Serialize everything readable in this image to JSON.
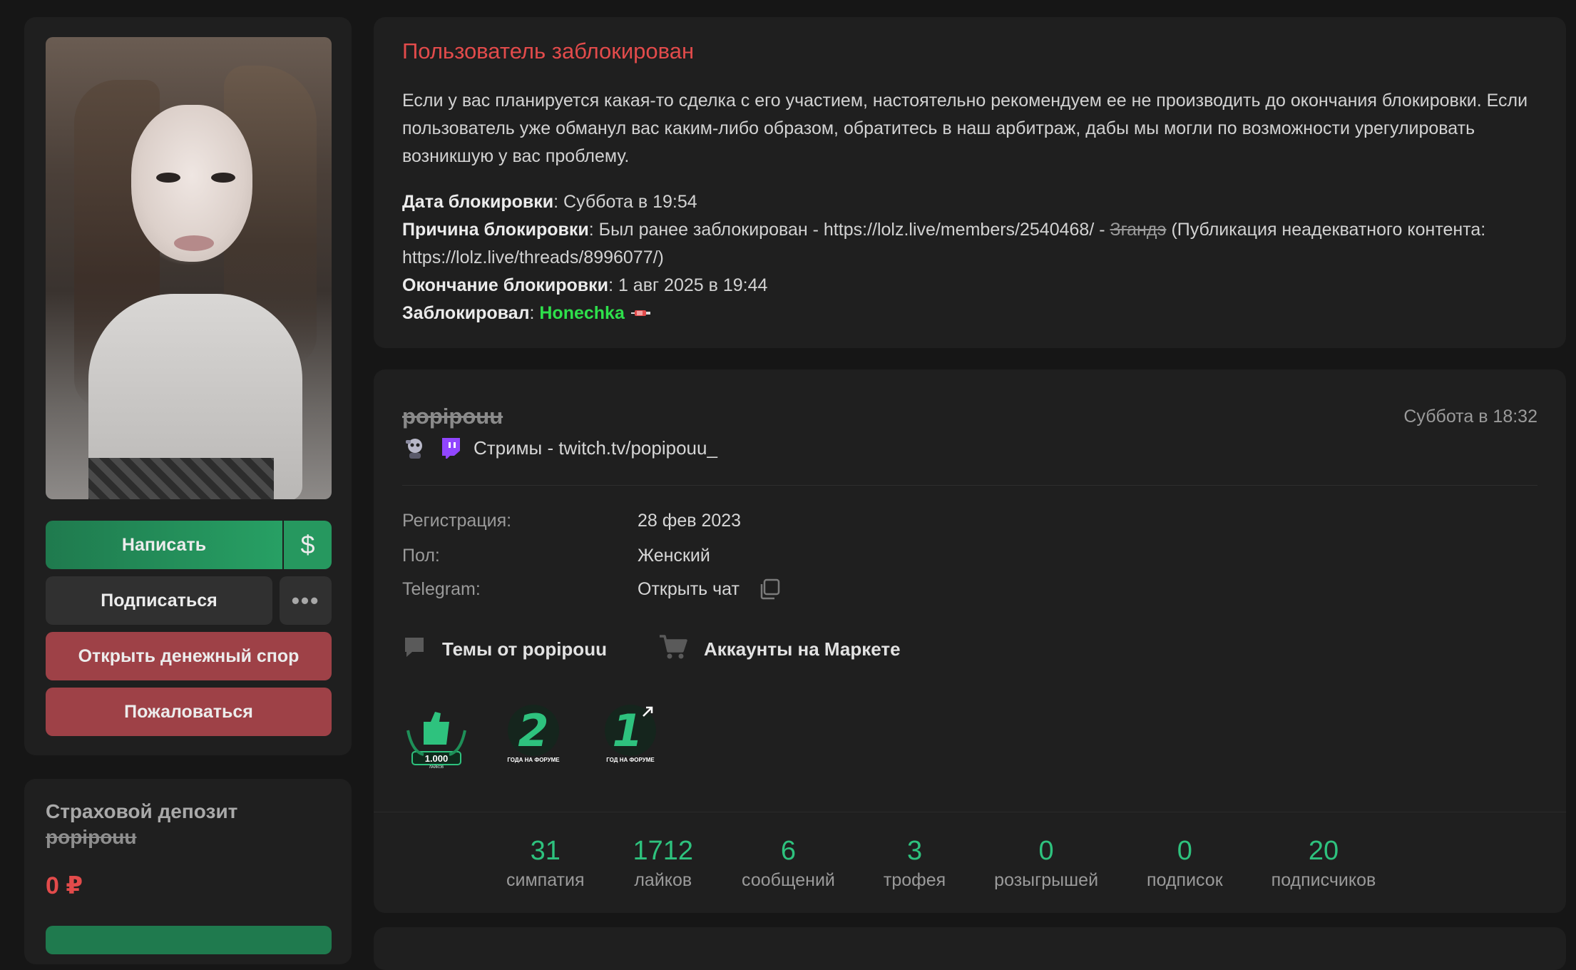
{
  "sidebar": {
    "buttons": {
      "write": "Написать",
      "dollar": "$",
      "subscribe": "Подписаться",
      "more": "•••",
      "dispute": "Открыть денежный спор",
      "report": "Пожаловаться"
    },
    "deposit": {
      "title": "Страховой депозит",
      "user": "popipouu",
      "amount": "0 ₽"
    }
  },
  "ban": {
    "title": "Пользователь заблокирован",
    "notice": "Если у вас планируется какая-то сделка с его участием, настоятельно рекомендуем ее не производить до окончания блокировки. Если пользователь уже обманул вас каким-либо образом, обратитесь в наш арбитраж, дабы мы могли по возможности урегулировать возникшую у вас проблему.",
    "date_label": "Дата блокировки",
    "date_value": ": Суббота в 19:54",
    "reason_label": "Причина блокировки",
    "reason_prefix": ": Был ранее заблокирован - https://lolz.live/members/2540468/ - ",
    "reason_strike": "Згандэ",
    "reason_suffix": " (Публикация неадекватного контента: https://lolz.live/threads/8996077/)",
    "end_label": "Окончание блокировки",
    "end_value": ": 1 авг 2025 в 19:44",
    "by_label": "Заблокировал",
    "by_sep": ": ",
    "by_name": "Honechka"
  },
  "profile": {
    "username": "popipouu",
    "last_seen": "Суббота в 18:32",
    "status": "Стримы - twitch.tv/popipouu_",
    "info": [
      {
        "label": "Регистрация:",
        "value": "28 фев 2023"
      },
      {
        "label": "Пол:",
        "value": "Женский"
      },
      {
        "label": "Telegram:",
        "value": "Открыть чат"
      }
    ],
    "links": {
      "topics": "Темы от popipouu",
      "market": "Аккаунты на Маркете"
    },
    "trophies": [
      {
        "name": "1.000",
        "caption": "ЛАЙКОВ",
        "icon": "likes-trophy-icon"
      },
      {
        "name": "2",
        "caption": "ГОДА НА ФОРУМЕ",
        "icon": "two-years-trophy-icon"
      },
      {
        "name": "1",
        "caption": "ГОД НА ФОРУМЕ",
        "icon": "one-year-trophy-icon"
      }
    ],
    "stats": [
      {
        "value": "31",
        "label": "симпатия"
      },
      {
        "value": "1712",
        "label": "лайков"
      },
      {
        "value": "6",
        "label": "сообщений"
      },
      {
        "value": "3",
        "label": "трофея"
      },
      {
        "value": "0",
        "label": "розыгрышей"
      },
      {
        "value": "0",
        "label": "подписок"
      },
      {
        "value": "20",
        "label": "подписчиков"
      }
    ]
  },
  "colors": {
    "accent_green": "#2ec27e",
    "danger_red": "#e24b4b",
    "name_green": "#2ee04b"
  }
}
